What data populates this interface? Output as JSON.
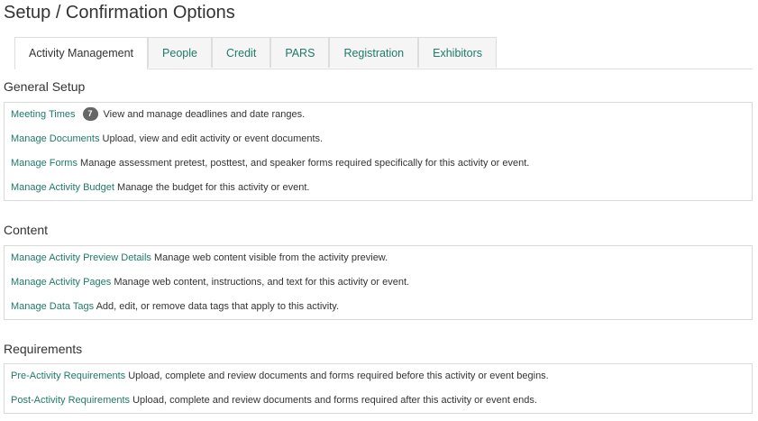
{
  "page_title": "Setup / Confirmation Options",
  "tabs": [
    {
      "label": "Activity Management",
      "active": true
    },
    {
      "label": "People"
    },
    {
      "label": "Credit"
    },
    {
      "label": "PARS"
    },
    {
      "label": "Registration"
    },
    {
      "label": "Exhibitors"
    }
  ],
  "sections": {
    "general": {
      "title": "General Setup",
      "items": [
        {
          "link": "Meeting Times",
          "badge": "7",
          "desc": "View and manage deadlines and date ranges."
        },
        {
          "link": "Manage Documents",
          "desc": "Upload, view and edit activity or event documents."
        },
        {
          "link": "Manage Forms",
          "desc": "Manage assessment pretest, posttest, and speaker forms required specifically for this activity or event."
        },
        {
          "link": "Manage Activity Budget",
          "desc": "Manage the budget for this activity or event."
        }
      ]
    },
    "content": {
      "title": "Content",
      "items": [
        {
          "link": "Manage Activity Preview Details",
          "desc": "Manage web content visible from the activity preview."
        },
        {
          "link": "Manage Activity Pages",
          "desc": "Manage web content, instructions, and text for this activity or event."
        },
        {
          "link": "Manage Data Tags",
          "desc": "Add, edit, or remove data tags that apply to this activity."
        }
      ]
    },
    "requirements": {
      "title": "Requirements",
      "items": [
        {
          "link": "Pre-Activity Requirements",
          "desc": "Upload, complete and review documents and forms required before this activity or event begins."
        },
        {
          "link": "Post-Activity Requirements",
          "desc": "Upload, complete and review documents and forms required after this activity or event ends."
        }
      ]
    }
  },
  "colors": {
    "link": "#1f7a6a",
    "text": "#333333",
    "badge_bg": "#666666",
    "border": "#d9d9d9"
  }
}
